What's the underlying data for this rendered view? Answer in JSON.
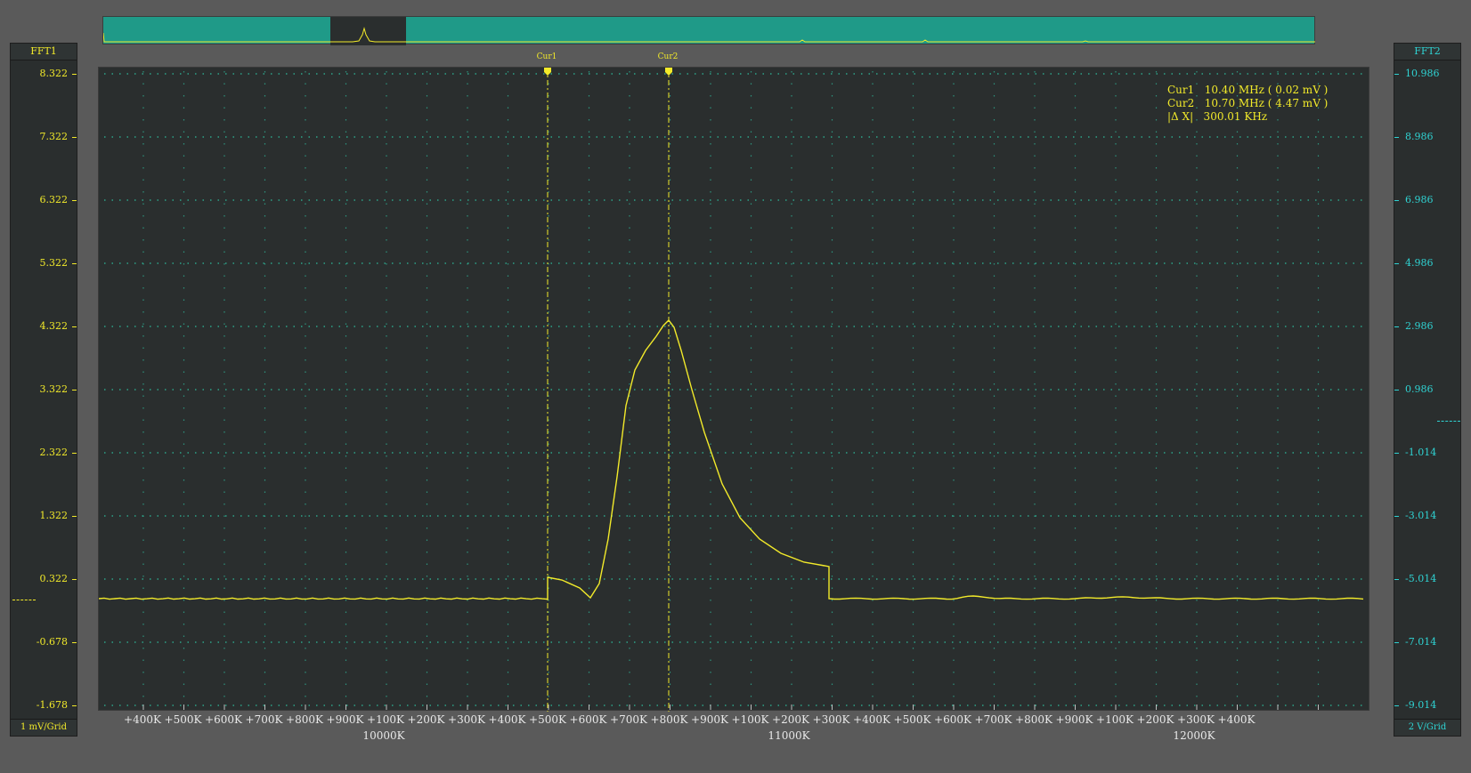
{
  "left_axis": {
    "title": "FFT1",
    "scale": "1 mV/Grid",
    "ticks": [
      "8.322",
      "7.322",
      "6.322",
      "5.322",
      "4.322",
      "3.322",
      "2.322",
      "1.322",
      "0.322",
      "-0.678",
      "-1.678"
    ],
    "color": "#f2ea2a"
  },
  "right_axis": {
    "title": "FFT2",
    "scale": "2 V/Grid",
    "ticks": [
      "10.986",
      "8.986",
      "6.986",
      "4.986",
      "2.986",
      "0.986",
      "-1.014",
      "-3.014",
      "-5.014",
      "-7.014",
      "-9.014"
    ],
    "color": "#2fd3d3"
  },
  "cursors": {
    "cur1": {
      "label": "Cur1",
      "text": "Cur1   10.40 MHz ( 0.02 mV )"
    },
    "cur2": {
      "label": "Cur2",
      "text": "Cur2   10.70 MHz ( 4.47 mV )"
    },
    "delta": {
      "text": "|Δ X|   300.01 KHz"
    }
  },
  "x_axis": {
    "ticks": [
      "+400K",
      "+500K",
      "+600K",
      "+700K",
      "+800K",
      "+900K",
      "+100K",
      "+200K",
      "+300K",
      "+400K",
      "+500K",
      "+600K",
      "+700K",
      "+800K",
      "+900K",
      "+100K",
      "+200K",
      "+300K",
      "+400K",
      "+500K",
      "+600K",
      "+700K",
      "+800K",
      "+900K",
      "+100K",
      "+200K",
      "+300K",
      "+400K"
    ],
    "majors": [
      "10000K",
      "11000K",
      "12000K"
    ]
  },
  "colors": {
    "trace": "#f2ea2a",
    "grid": "#2fd3b0",
    "plot_bg": "#2a2e2e",
    "overview_bg": "#1f9a88"
  }
}
